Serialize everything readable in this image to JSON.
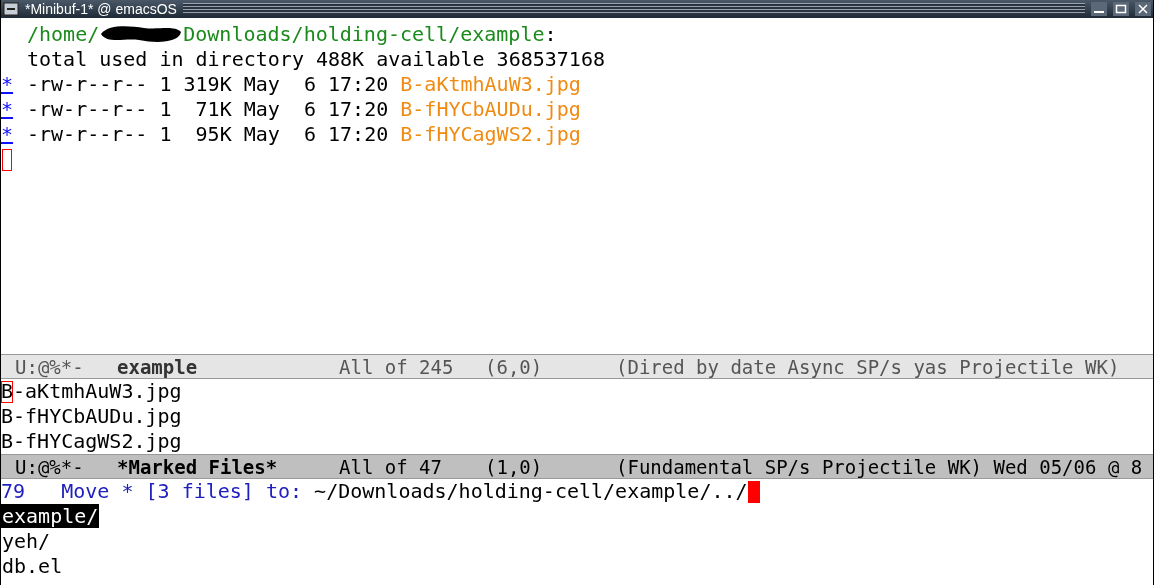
{
  "window": {
    "title": "*Minibuf-1* @ emacsOS"
  },
  "dired": {
    "path_start": "/home/",
    "path_end": "Downloads/holding-cell/example",
    "path_suffix": ":",
    "summary": "total used in directory 488K available 368537168",
    "files": [
      {
        "marked": true,
        "mark": "*",
        "details": "-rw-r--r-- 1 319K May  6 17:20",
        "name": "B-aKtmhAuW3.jpg"
      },
      {
        "marked": true,
        "mark": "*",
        "details": "-rw-r--r-- 1  71K May  6 17:20",
        "name": "B-fHYCbAUDu.jpg"
      },
      {
        "marked": true,
        "mark": "*",
        "details": "-rw-r--r-- 1  95K May  6 17:20",
        "name": "B-fHYCagWS2.jpg"
      }
    ]
  },
  "modeline_top": {
    "active": false,
    "flags": "U:@%*-",
    "buffer": "example",
    "position": "All of 245",
    "coords": "(6,0)",
    "modes": "(Dired by date Async SP/s yas Projectile WK)"
  },
  "marked_files": {
    "lines": [
      "B-aKtmhAuW3.jpg",
      "B-fHYCbAUDu.jpg",
      "B-fHYCagWS2.jpg"
    ]
  },
  "modeline_bottom": {
    "active": true,
    "flags": "U:@%*-",
    "buffer": "*Marked Files*",
    "position": "All of 47",
    "coords": "(1,0)",
    "modes": "(Fundamental SP/s Projectile WK) Wed 05/06 @ 8"
  },
  "minibuffer": {
    "count": "79",
    "prompt": "Move * [3 files] to: ",
    "value": "~/Downloads/holding-cell/example/../"
  },
  "completions": [
    {
      "text": "example/",
      "selected": true
    },
    {
      "text": "yeh/",
      "selected": false
    },
    {
      "text": "db.el",
      "selected": false
    }
  ]
}
